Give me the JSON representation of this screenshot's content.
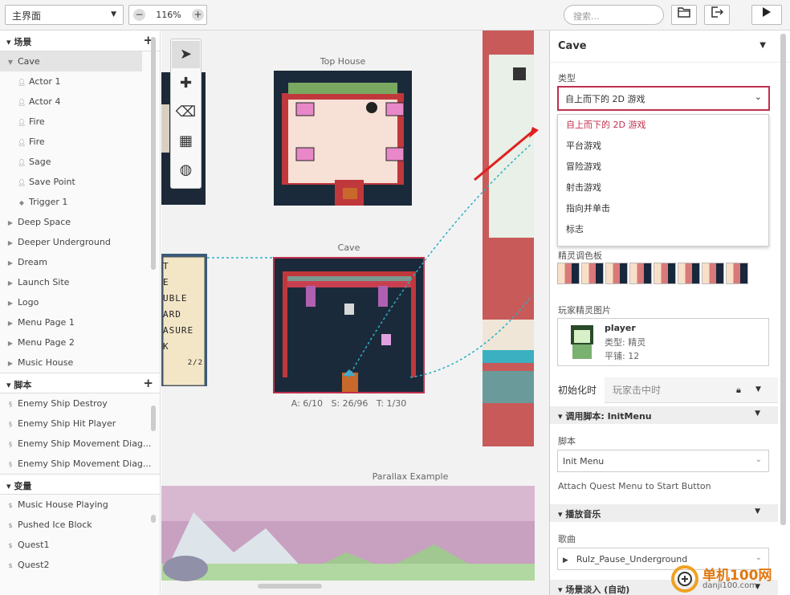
{
  "toolbar": {
    "view_select": "主界面",
    "zoom": "116%",
    "search_placeholder": "搜索..."
  },
  "left": {
    "scenes_title": "场景",
    "scenes": [
      {
        "label": "Cave",
        "kind": "scene-open",
        "selected": true
      },
      {
        "label": "Actor 1",
        "kind": "actor"
      },
      {
        "label": "Actor 4",
        "kind": "actor"
      },
      {
        "label": "Fire",
        "kind": "actor"
      },
      {
        "label": "Fire",
        "kind": "actor"
      },
      {
        "label": "Sage",
        "kind": "actor"
      },
      {
        "label": "Save Point",
        "kind": "actor"
      },
      {
        "label": "Trigger 1",
        "kind": "trigger"
      },
      {
        "label": "Deep Space",
        "kind": "scene"
      },
      {
        "label": "Deeper Underground",
        "kind": "scene"
      },
      {
        "label": "Dream",
        "kind": "scene"
      },
      {
        "label": "Launch Site",
        "kind": "scene"
      },
      {
        "label": "Logo",
        "kind": "scene"
      },
      {
        "label": "Menu Page 1",
        "kind": "scene"
      },
      {
        "label": "Menu Page 2",
        "kind": "scene"
      },
      {
        "label": "Music House",
        "kind": "scene"
      }
    ],
    "scripts_title": "脚本",
    "scripts": [
      "Enemy Ship Destroy",
      "Enemy Ship Hit Player",
      "Enemy Ship Movement Diag...",
      "Enemy Ship Movement Diag..."
    ],
    "vars_title": "变量",
    "vars": [
      "Music House Playing",
      "Pushed Ice Block",
      "Quest1",
      "Quest2"
    ]
  },
  "canvas": {
    "scene_top_house": "Top House",
    "scene_cave": "Cave",
    "cave_stats": "A: 6/10   S: 26/96   T: 1/30",
    "scene_parallax": "Parallax Example",
    "dialog_lines": [
      "T",
      "E",
      "UBLE",
      "ARD",
      "ASURE",
      "K",
      "2/2"
    ]
  },
  "right": {
    "title": "Cave",
    "type_label": "类型",
    "type_value": "自上而下的 2D 游戏",
    "type_options": [
      "自上而下的 2D 游戏",
      "平台游戏",
      "冒险游戏",
      "射击游戏",
      "指向并单击",
      "标志"
    ],
    "sprite_palette_label": "精灵调色板",
    "player_sprite_label": "玩家精灵图片",
    "player_name": "player",
    "player_type": "类型:  精灵",
    "player_frames": "平铺:  12",
    "tab_init": "初始化时",
    "tab_hit": "玩家击中时",
    "section_call": "调用脚本: InitMenu",
    "script_label": "脚本",
    "script_value": "Init Menu",
    "script_desc": "Attach Quest Menu to Start Button",
    "section_music": "播放音乐",
    "song_label": "歌曲",
    "song_value": "Rulz_Pause_Underground",
    "section_fade": "场景淡入 (自动)"
  },
  "watermark": {
    "line1": "单机100网",
    "line2": "danji100.com"
  }
}
